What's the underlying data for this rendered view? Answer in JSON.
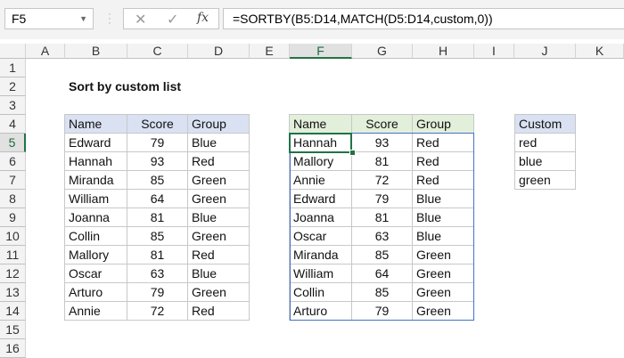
{
  "name_box": "F5",
  "formula": "=SORTBY(B5:D14,MATCH(D5:D14,custom,0))",
  "fx_label": "fx",
  "columns": [
    "A",
    "B",
    "C",
    "D",
    "E",
    "F",
    "G",
    "H",
    "I",
    "J",
    "K"
  ],
  "rows": [
    "1",
    "2",
    "3",
    "4",
    "5",
    "6",
    "7",
    "8",
    "9",
    "10",
    "11",
    "12",
    "13",
    "14",
    "15",
    "16"
  ],
  "title": "Sort by custom list",
  "source_table": {
    "headers": [
      "Name",
      "Score",
      "Group"
    ],
    "rows": [
      [
        "Edward",
        "79",
        "Blue"
      ],
      [
        "Hannah",
        "93",
        "Red"
      ],
      [
        "Miranda",
        "85",
        "Green"
      ],
      [
        "William",
        "64",
        "Green"
      ],
      [
        "Joanna",
        "81",
        "Blue"
      ],
      [
        "Collin",
        "85",
        "Green"
      ],
      [
        "Mallory",
        "81",
        "Red"
      ],
      [
        "Oscar",
        "63",
        "Blue"
      ],
      [
        "Arturo",
        "79",
        "Green"
      ],
      [
        "Annie",
        "72",
        "Red"
      ]
    ]
  },
  "sorted_table": {
    "headers": [
      "Name",
      "Score",
      "Group"
    ],
    "rows": [
      [
        "Hannah",
        "93",
        "Red"
      ],
      [
        "Mallory",
        "81",
        "Red"
      ],
      [
        "Annie",
        "72",
        "Red"
      ],
      [
        "Edward",
        "79",
        "Blue"
      ],
      [
        "Joanna",
        "81",
        "Blue"
      ],
      [
        "Oscar",
        "63",
        "Blue"
      ],
      [
        "Miranda",
        "85",
        "Green"
      ],
      [
        "William",
        "64",
        "Green"
      ],
      [
        "Collin",
        "85",
        "Green"
      ],
      [
        "Arturo",
        "79",
        "Green"
      ]
    ]
  },
  "custom_table": {
    "header": "Custom",
    "rows": [
      "red",
      "blue",
      "green"
    ]
  },
  "colors": {
    "blue_header": "#d9e1f2",
    "green_header": "#e2efda",
    "selection": "#217346",
    "spill_border": "#4472c4"
  }
}
